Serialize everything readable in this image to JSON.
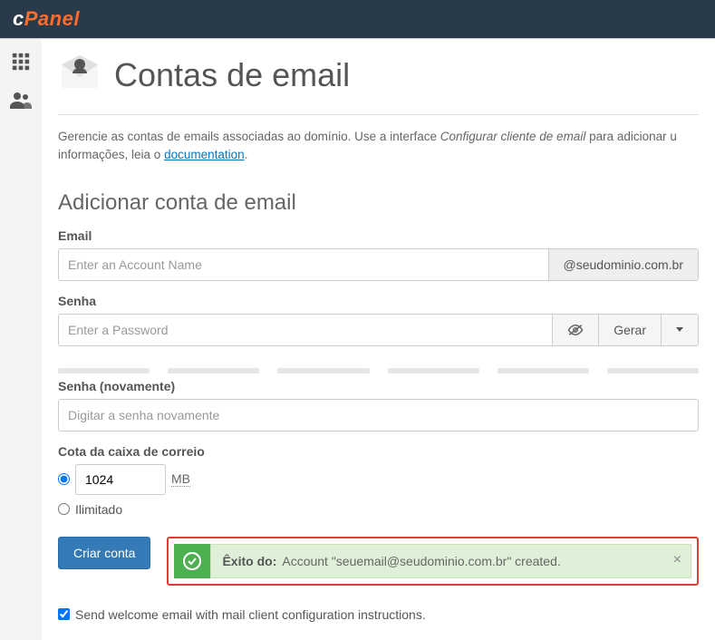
{
  "brand": {
    "c": "c",
    "panel": "Panel"
  },
  "page": {
    "title": "Contas de email",
    "description_prefix": "Gerencie as contas de emails associadas ao domínio. Use a interface ",
    "description_em": "Configurar cliente de email",
    "description_suffix1": " para adicionar u",
    "description_suffix2": "informações, leia o ",
    "description_link": "documentation",
    "description_period": "."
  },
  "section": {
    "add_title": "Adicionar conta de email"
  },
  "fields": {
    "email_label": "Email",
    "email_placeholder": "Enter an Account Name",
    "domain_addon": "@seudominio.com.br",
    "password_label": "Senha",
    "password_placeholder": "Enter a Password",
    "generate_label": "Gerar",
    "password_again_label": "Senha (novamente)",
    "password_again_placeholder": "Digitar a senha novamente",
    "quota_label": "Cota da caixa de correio",
    "quota_value": "1024",
    "quota_unit": "MB",
    "unlimited_label": "Ilimitado"
  },
  "actions": {
    "create_label": "Criar conta"
  },
  "alert": {
    "heading": "Êxito do:",
    "message": "Account \"seuemail@seudominio.com.br\" created."
  },
  "welcome": {
    "label": "Send welcome email with mail client configuration instructions."
  }
}
